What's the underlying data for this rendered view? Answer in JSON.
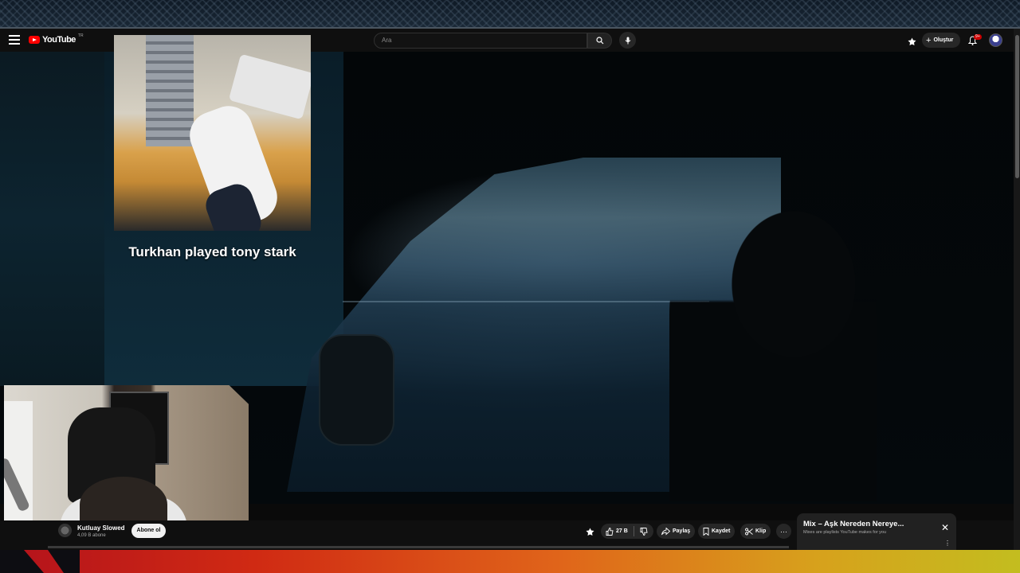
{
  "header": {
    "logo_text": "YouTube",
    "logo_country": "TR",
    "search_placeholder": "Ara",
    "create_label": "Oluştur",
    "notification_count": "9+"
  },
  "video": {
    "overlay_caption": "Turkhan played tony stark"
  },
  "channel": {
    "name": "Kutluay Slowed",
    "subscribers": "4,09 B abone",
    "subscribe_label": "Abone ol"
  },
  "actions": {
    "like_count": "27 B",
    "share_label": "Paylaş",
    "save_label": "Kaydet",
    "clip_label": "Klip"
  },
  "mix": {
    "title": "Mix – Aşk Nereden Nereye...",
    "subtitle": "Mixes are playlists YouTube makes for you"
  },
  "colors": {
    "brand_red": "#ff0000",
    "topbar_bg": "#0f0f0f",
    "pill_bg": "#272727"
  }
}
